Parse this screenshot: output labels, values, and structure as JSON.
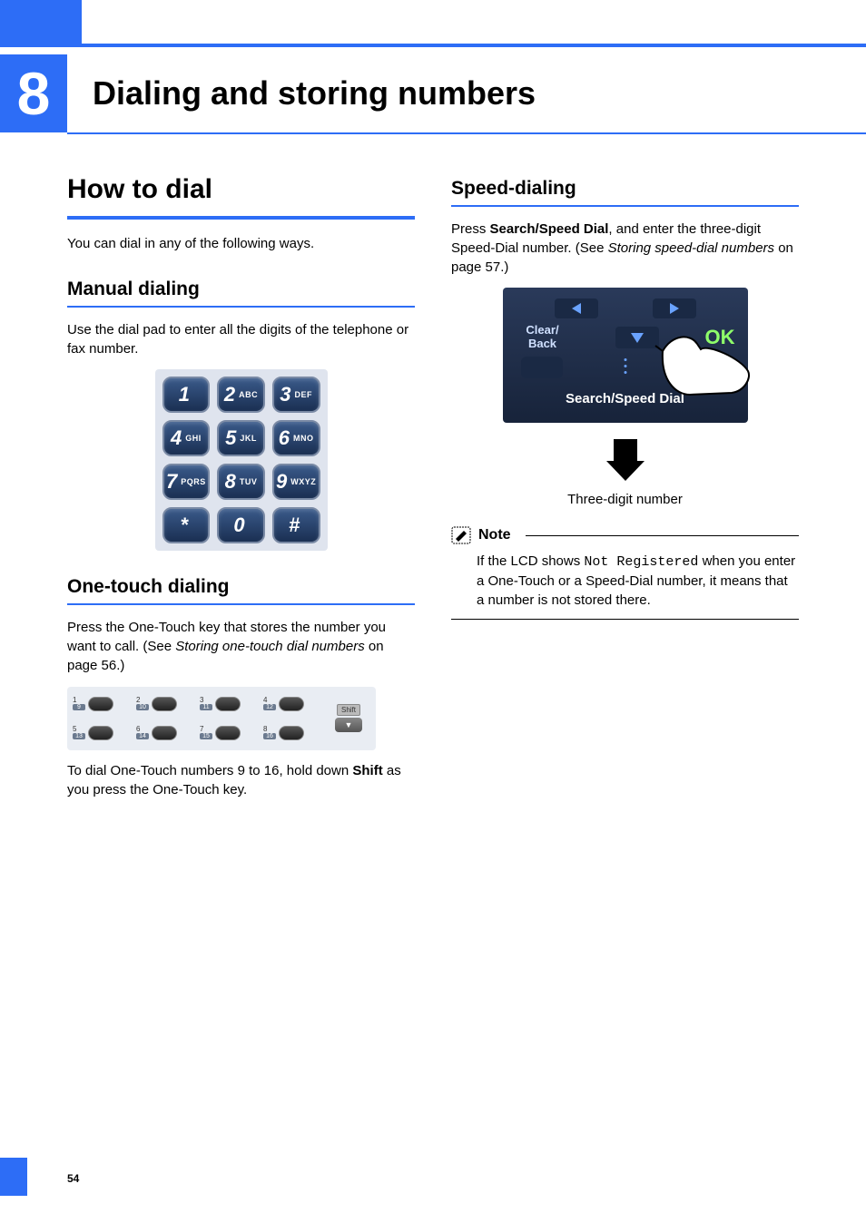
{
  "chapter": {
    "number": "8",
    "title": "Dialing and storing numbers"
  },
  "page_number": "54",
  "left": {
    "h1": "How to dial",
    "intro": "You can dial in any of the following ways.",
    "manual": {
      "heading": "Manual dialing",
      "body": "Use the dial pad to enter all the digits of the telephone or fax number.",
      "keys": [
        {
          "big": "1",
          "sm": ""
        },
        {
          "big": "2",
          "sm": "ABC"
        },
        {
          "big": "3",
          "sm": "DEF"
        },
        {
          "big": "4",
          "sm": "GHI"
        },
        {
          "big": "5",
          "sm": "JKL"
        },
        {
          "big": "6",
          "sm": "MNO"
        },
        {
          "big": "7",
          "sm": "PQRS"
        },
        {
          "big": "8",
          "sm": "TUV"
        },
        {
          "big": "9",
          "sm": "WXYZ"
        },
        {
          "big": "*",
          "sm": ""
        },
        {
          "big": "0",
          "sm": ""
        },
        {
          "big": "#",
          "sm": ""
        }
      ]
    },
    "onetouch": {
      "heading": "One-touch dialing",
      "body_pre": "Press the One-Touch key that stores the number you want to call. (See ",
      "body_link": "Storing one-touch dial numbers",
      "body_post": " on page 56.)",
      "rows": [
        [
          {
            "n": "1",
            "alt": "9"
          },
          {
            "n": "2",
            "alt": "10"
          },
          {
            "n": "3",
            "alt": "11"
          },
          {
            "n": "4",
            "alt": "12"
          }
        ],
        [
          {
            "n": "5",
            "alt": "13"
          },
          {
            "n": "6",
            "alt": "14"
          },
          {
            "n": "7",
            "alt": "15"
          },
          {
            "n": "8",
            "alt": "16"
          }
        ]
      ],
      "shift_label": "Shift",
      "after_pre": "To dial One-Touch numbers 9 to 16, hold down ",
      "after_bold": "Shift",
      "after_post": " as you press the One-Touch key."
    }
  },
  "right": {
    "speed": {
      "heading": "Speed-dialing",
      "p_pre": "Press ",
      "p_bold": "Search/Speed Dial",
      "p_mid": ", and enter the three-digit Speed-Dial number. (See ",
      "p_link": "Storing speed-dial numbers",
      "p_post": " on page 57.)",
      "panel": {
        "clear_back": "Clear/\nBack",
        "ok": "OK",
        "label": "Search/Speed Dial"
      },
      "caption": "Three-digit number"
    },
    "note": {
      "title": "Note",
      "pre": "If the LCD shows ",
      "mono": "Not Registered",
      "post": " when you enter a One-Touch or a Speed-Dial number, it means that a number is not stored there."
    }
  }
}
